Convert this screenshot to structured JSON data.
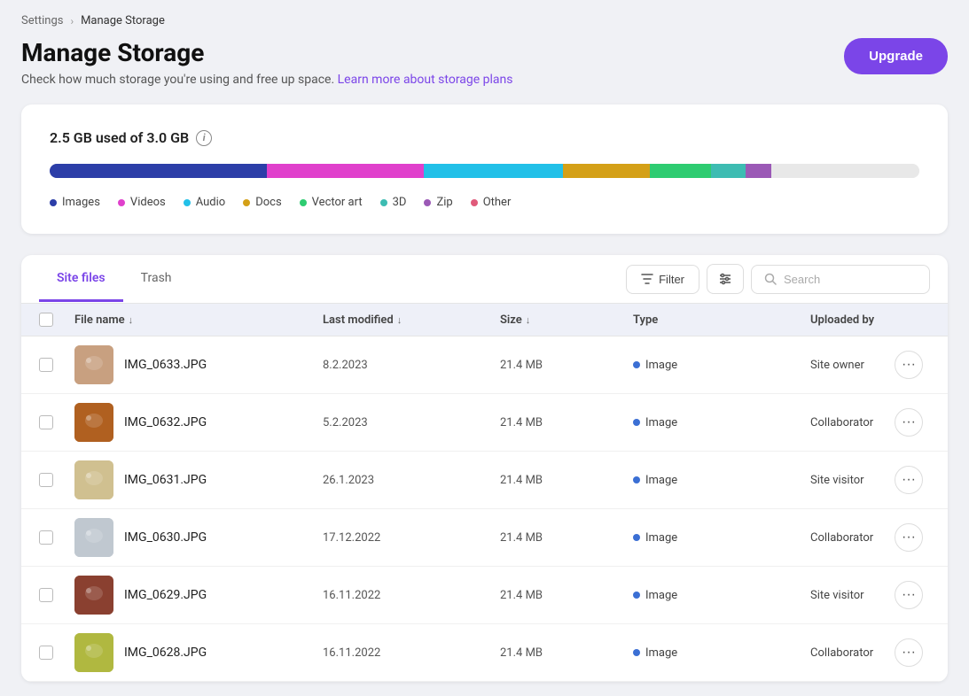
{
  "breadcrumb": {
    "parent": "Settings",
    "separator": "›",
    "current": "Manage Storage"
  },
  "header": {
    "title": "Manage Storage",
    "subtitle": "Check how much storage you're using and free up space.",
    "learn_more_text": "Learn more about storage plans",
    "upgrade_btn": "Upgrade"
  },
  "storage": {
    "used_label": "2.5 GB used of 3.0 GB",
    "info_symbol": "i",
    "bar_segments": [
      {
        "color": "#2c3ea8",
        "width": 25
      },
      {
        "color": "#e040cc",
        "width": 18
      },
      {
        "color": "#22c0e8",
        "width": 16
      },
      {
        "color": "#d4a017",
        "width": 10
      },
      {
        "color": "#2ecc71",
        "width": 7
      },
      {
        "color": "#3dbcb2",
        "width": 4
      },
      {
        "color": "#9b59b6",
        "width": 3
      },
      {
        "color": "#e8e8e8",
        "width": 17
      }
    ],
    "legend": [
      {
        "label": "Images",
        "color": "#2c3ea8"
      },
      {
        "label": "Videos",
        "color": "#e040cc"
      },
      {
        "label": "Audio",
        "color": "#22c0e8"
      },
      {
        "label": "Docs",
        "color": "#d4a017"
      },
      {
        "label": "Vector art",
        "color": "#2ecc71"
      },
      {
        "label": "3D",
        "color": "#3dbcb2"
      },
      {
        "label": "Zip",
        "color": "#9b59b6"
      },
      {
        "label": "Other",
        "color": "#e05a7a"
      }
    ]
  },
  "tabs": [
    {
      "label": "Site files",
      "active": true
    },
    {
      "label": "Trash",
      "active": false
    }
  ],
  "toolbar": {
    "filter_btn": "Filter",
    "search_placeholder": "Search"
  },
  "table": {
    "headers": [
      {
        "label": "File name",
        "sortable": true
      },
      {
        "label": "Last modified",
        "sortable": true
      },
      {
        "label": "Size",
        "sortable": true
      },
      {
        "label": "Type",
        "sortable": false
      },
      {
        "label": "Uploaded by",
        "sortable": false
      }
    ],
    "rows": [
      {
        "id": 1,
        "name": "IMG_0633.JPG",
        "date": "8.2.2023",
        "size": "21.4 MB",
        "type": "Image",
        "type_color": "#3b6fd4",
        "uploader": "Site owner",
        "thumb_id": 1
      },
      {
        "id": 2,
        "name": "IMG_0632.JPG",
        "date": "5.2.2023",
        "size": "21.4 MB",
        "type": "Image",
        "type_color": "#3b6fd4",
        "uploader": "Collaborator",
        "thumb_id": 2
      },
      {
        "id": 3,
        "name": "IMG_0631.JPG",
        "date": "26.1.2023",
        "size": "21.4 MB",
        "type": "Image",
        "type_color": "#3b6fd4",
        "uploader": "Site visitor",
        "thumb_id": 3
      },
      {
        "id": 4,
        "name": "IMG_0630.JPG",
        "date": "17.12.2022",
        "size": "21.4 MB",
        "type": "Image",
        "type_color": "#3b6fd4",
        "uploader": "Collaborator",
        "thumb_id": 4
      },
      {
        "id": 5,
        "name": "IMG_0629.JPG",
        "date": "16.11.2022",
        "size": "21.4 MB",
        "type": "Image",
        "type_color": "#3b6fd4",
        "uploader": "Site visitor",
        "thumb_id": 5
      },
      {
        "id": 6,
        "name": "IMG_0628.JPG",
        "date": "16.11.2022",
        "size": "21.4 MB",
        "type": "Image",
        "type_color": "#3b6fd4",
        "uploader": "Collaborator",
        "thumb_id": 6
      }
    ]
  },
  "thumb_colors": [
    "#c8a080",
    "#b06020",
    "#d0c090",
    "#c0c8d0",
    "#8a4030",
    "#b0b840"
  ],
  "accent_color": "#7b45e8"
}
